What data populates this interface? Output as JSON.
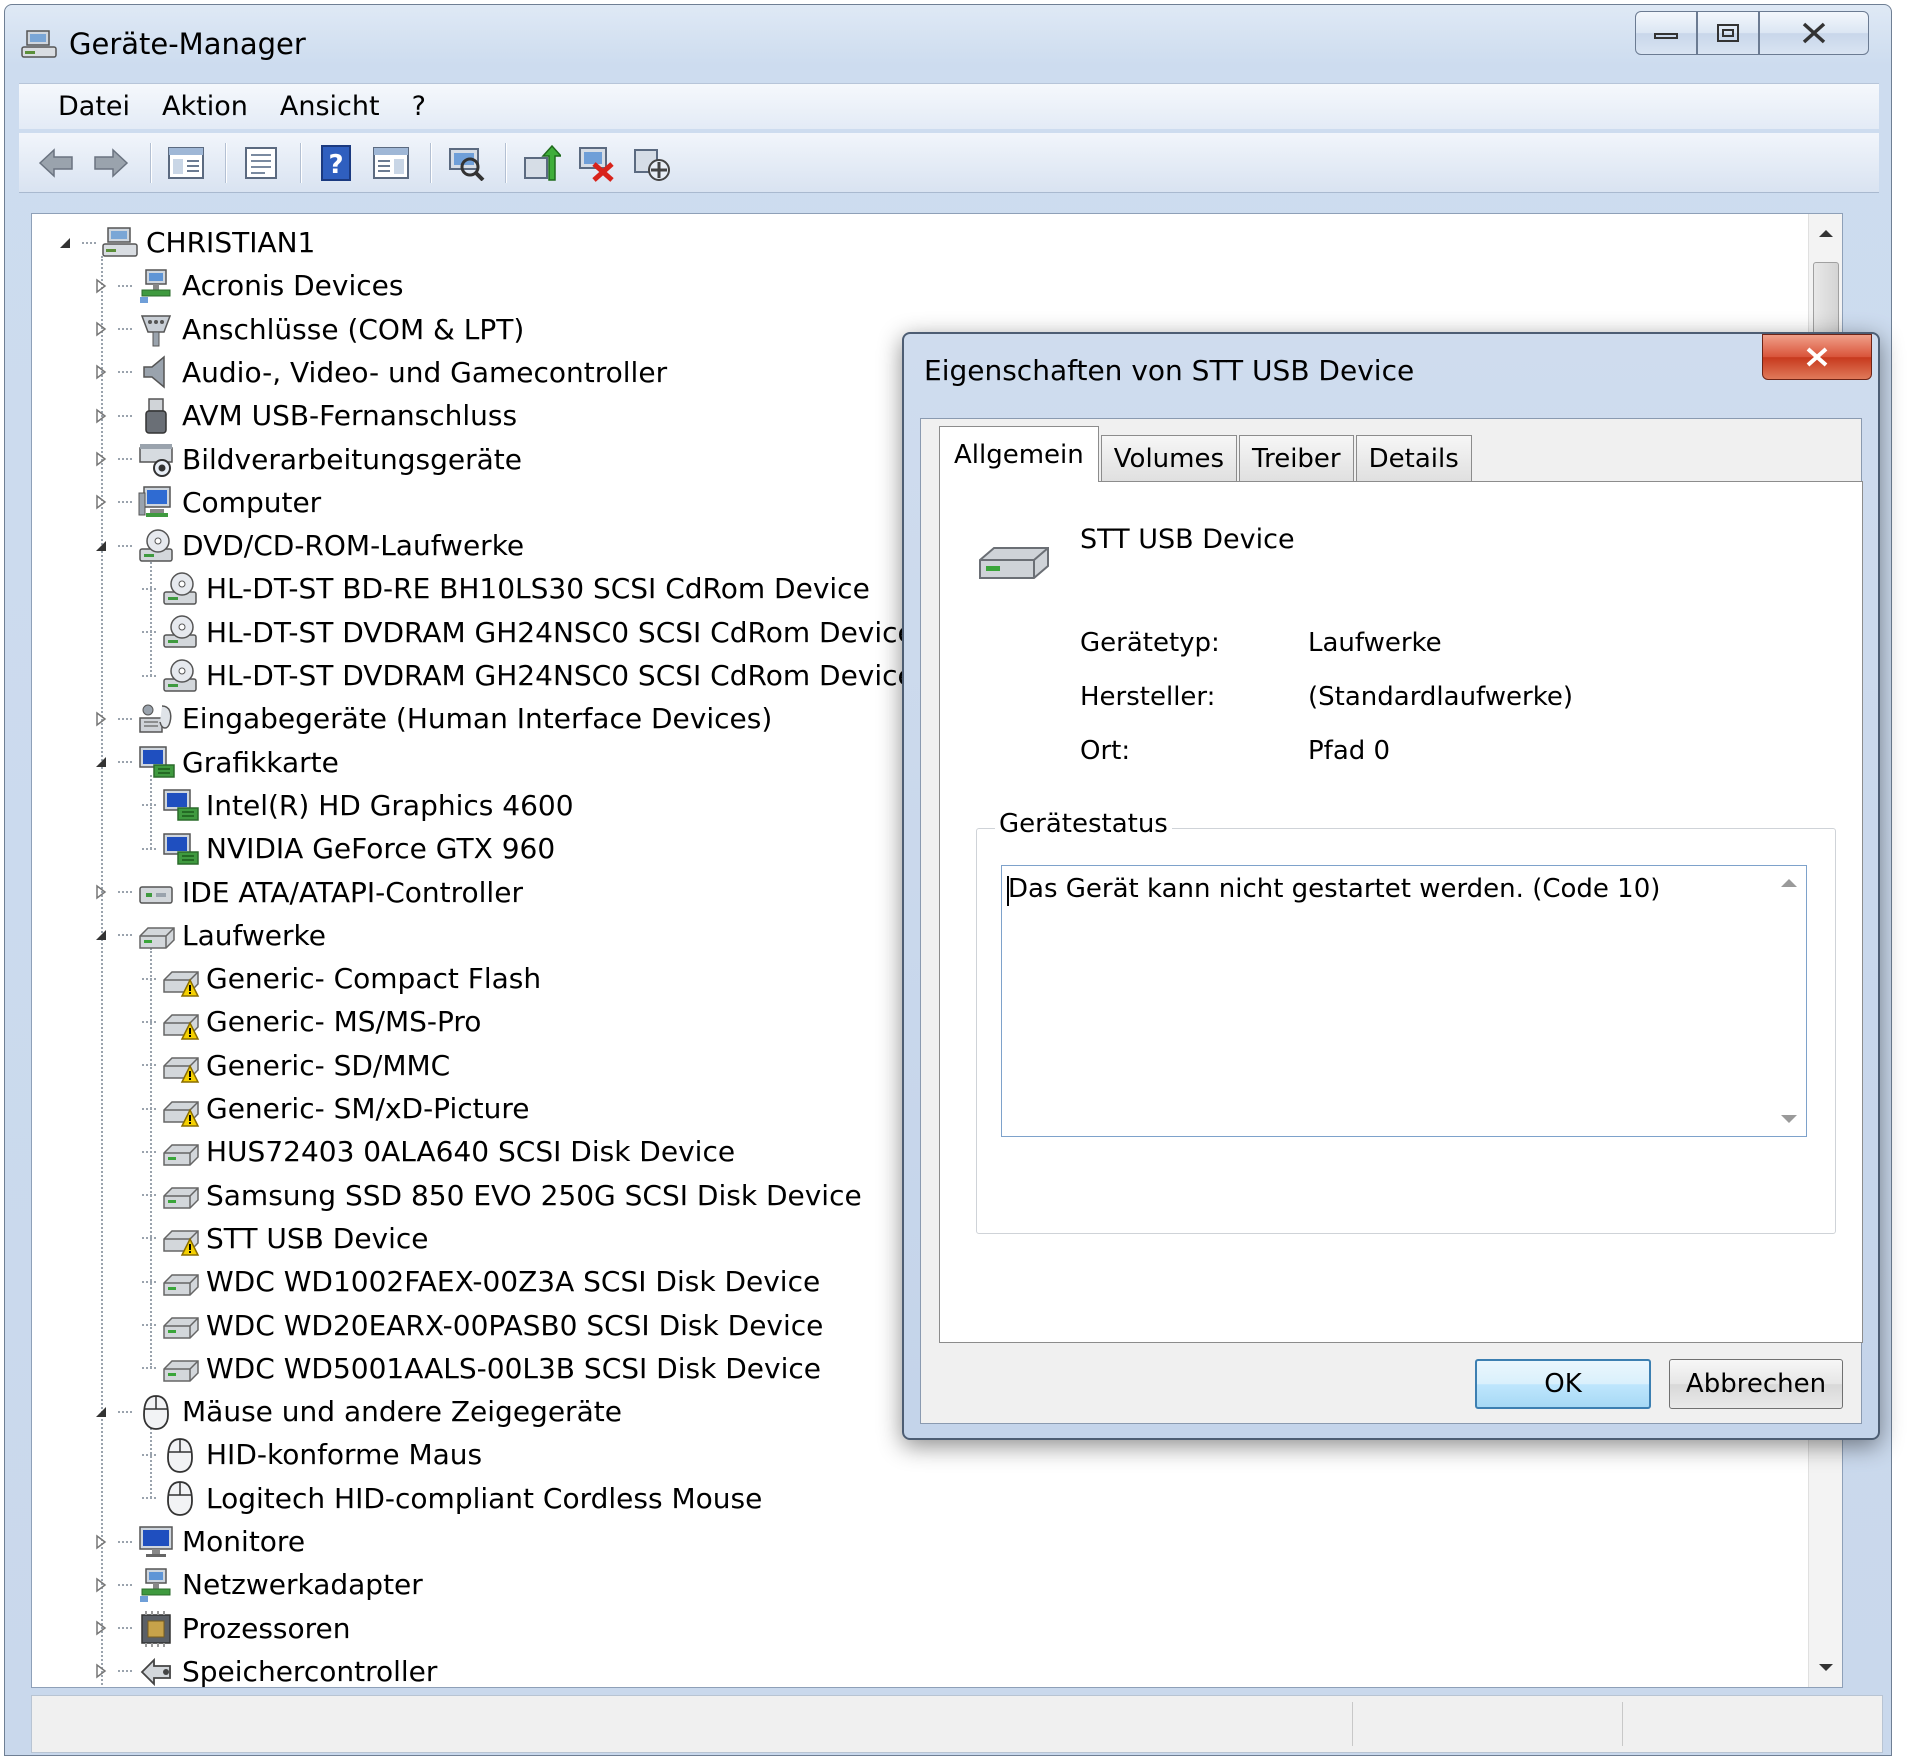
{
  "window": {
    "title": "Geräte-Manager"
  },
  "menu": [
    "Datei",
    "Aktion",
    "Ansicht",
    "?"
  ],
  "toolbar": {
    "icons": [
      "back-arrow-icon",
      "forward-arrow-icon",
      "show-hide-tree-icon",
      "properties-icon",
      "help-icon",
      "action-pane-icon",
      "scan-hardware-icon",
      "update-driver-icon",
      "uninstall-icon",
      "disable-device-icon"
    ]
  },
  "tree": {
    "root": "CHRISTIAN1",
    "items": [
      {
        "label": "Acronis Devices",
        "level": 1,
        "expanded": false,
        "icon": "network-icon"
      },
      {
        "label": "Anschlüsse (COM & LPT)",
        "level": 1,
        "expanded": false,
        "icon": "port-icon"
      },
      {
        "label": "Audio-, Video- und Gamecontroller",
        "level": 1,
        "expanded": false,
        "icon": "speaker-icon"
      },
      {
        "label": "AVM USB-Fernanschluss",
        "level": 1,
        "expanded": false,
        "icon": "usb-icon"
      },
      {
        "label": "Bildverarbeitungsgeräte",
        "level": 1,
        "expanded": false,
        "icon": "scanner-icon"
      },
      {
        "label": "Computer",
        "level": 1,
        "expanded": false,
        "icon": "computer-icon"
      },
      {
        "label": "DVD/CD-ROM-Laufwerke",
        "level": 1,
        "expanded": true,
        "icon": "cdrom-icon"
      },
      {
        "label": "HL-DT-ST BD-RE  BH10LS30 SCSI CdRom Device",
        "level": 2,
        "icon": "cdrom-icon"
      },
      {
        "label": "HL-DT-ST DVDRAM GH24NSC0 SCSI CdRom Device",
        "level": 2,
        "icon": "cdrom-icon"
      },
      {
        "label": "HL-DT-ST DVDRAM GH24NSC0 SCSI CdRom Device",
        "level": 2,
        "icon": "cdrom-icon"
      },
      {
        "label": "Eingabegeräte (Human Interface Devices)",
        "level": 1,
        "expanded": false,
        "icon": "hid-icon"
      },
      {
        "label": "Grafikkarte",
        "level": 1,
        "expanded": true,
        "icon": "display-adapter-icon"
      },
      {
        "label": "Intel(R) HD Graphics 4600",
        "level": 2,
        "icon": "display-adapter-icon"
      },
      {
        "label": "NVIDIA GeForce GTX 960",
        "level": 2,
        "icon": "display-adapter-icon"
      },
      {
        "label": "IDE ATA/ATAPI-Controller",
        "level": 1,
        "expanded": false,
        "icon": "controller-icon"
      },
      {
        "label": "Laufwerke",
        "level": 1,
        "expanded": true,
        "icon": "drive-icon"
      },
      {
        "label": "Generic- Compact Flash",
        "level": 2,
        "icon": "drive-warning-icon"
      },
      {
        "label": "Generic- MS/MS-Pro",
        "level": 2,
        "icon": "drive-warning-icon"
      },
      {
        "label": "Generic- SD/MMC",
        "level": 2,
        "icon": "drive-warning-icon"
      },
      {
        "label": "Generic- SM/xD-Picture",
        "level": 2,
        "icon": "drive-warning-icon"
      },
      {
        "label": "HUS72403 0ALA640 SCSI Disk Device",
        "level": 2,
        "icon": "drive-icon"
      },
      {
        "label": "Samsung SSD 850 EVO 250G SCSI Disk Device",
        "level": 2,
        "icon": "drive-icon"
      },
      {
        "label": "STT USB Device",
        "level": 2,
        "icon": "drive-warning-icon"
      },
      {
        "label": "WDC WD1002FAEX-00Z3A SCSI Disk Device",
        "level": 2,
        "icon": "drive-icon"
      },
      {
        "label": "WDC WD20EARX-00PASB0 SCSI Disk Device",
        "level": 2,
        "icon": "drive-icon"
      },
      {
        "label": "WDC WD5001AALS-00L3B SCSI Disk Device",
        "level": 2,
        "icon": "drive-icon"
      },
      {
        "label": "Mäuse und andere Zeigegeräte",
        "level": 1,
        "expanded": true,
        "icon": "mouse-icon"
      },
      {
        "label": "HID-konforme Maus",
        "level": 2,
        "icon": "mouse-icon"
      },
      {
        "label": "Logitech HID-compliant Cordless Mouse",
        "level": 2,
        "icon": "mouse-icon"
      },
      {
        "label": "Monitore",
        "level": 1,
        "expanded": false,
        "icon": "monitor-icon"
      },
      {
        "label": "Netzwerkadapter",
        "level": 1,
        "expanded": false,
        "icon": "network-icon"
      },
      {
        "label": "Prozessoren",
        "level": 1,
        "expanded": false,
        "icon": "cpu-icon"
      },
      {
        "label": "Speichercontroller",
        "level": 1,
        "expanded": false,
        "icon": "storage-controller-icon"
      }
    ]
  },
  "dialog": {
    "title": "Eigenschaften von STT USB Device",
    "tabs": [
      "Allgemein",
      "Volumes",
      "Treiber",
      "Details"
    ],
    "active_tab": "Allgemein",
    "device_name": "STT USB Device",
    "properties": [
      {
        "label": "Gerätetyp:",
        "value": "Laufwerke"
      },
      {
        "label": "Hersteller:",
        "value": "(Standardlaufwerke)"
      },
      {
        "label": "Ort:",
        "value": "Pfad 0"
      }
    ],
    "status_group_label": "Gerätestatus",
    "status_text": "Das Gerät kann nicht gestartet werden. (Code 10)",
    "ok_label": "OK",
    "cancel_label": "Abbrechen"
  },
  "colors": {
    "window_frame": "#cddcef",
    "warning": "#f5d000",
    "ok_button_border": "#3c7fb1",
    "close_button": "#c7391d"
  }
}
